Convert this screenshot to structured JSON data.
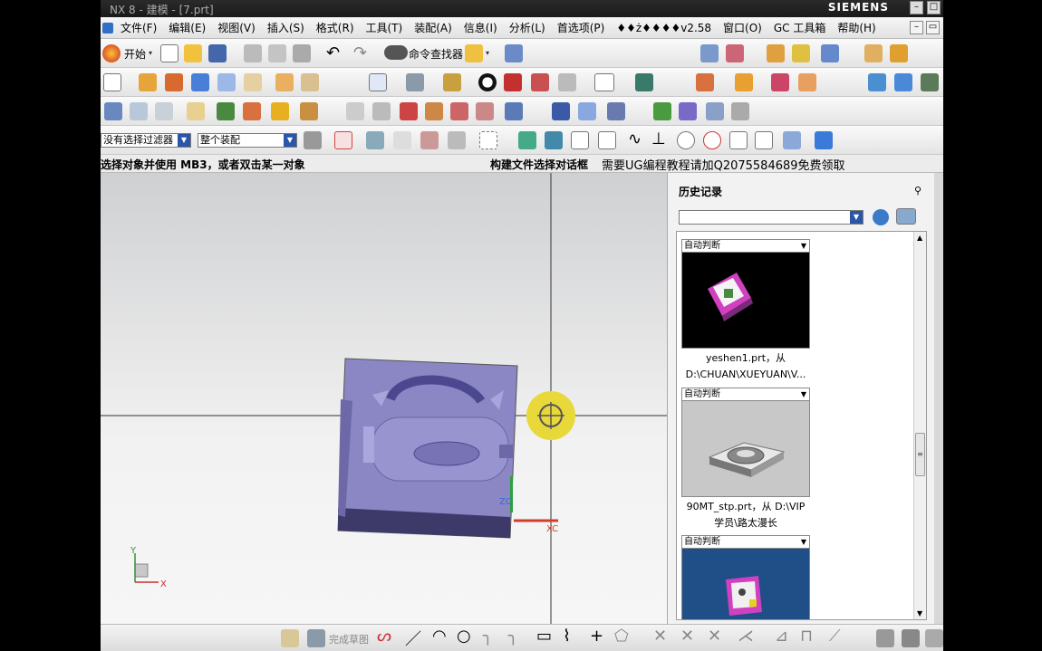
{
  "window": {
    "title": "NX 8 - 建模 - [7.prt]",
    "brand": "SIEMENS",
    "minimize": "–",
    "maximize": "□"
  },
  "menu": {
    "items": [
      "文件(F)",
      "编辑(E)",
      "视图(V)",
      "插入(S)",
      "格式(R)",
      "工具(T)",
      "装配(A)",
      "信息(I)",
      "分析(L)",
      "首选项(P)",
      "♦♦ż♦♦♦♦v2.58",
      "窗口(O)",
      "GC 工具箱",
      "帮助(H)"
    ],
    "mdi_minimize": "–",
    "mdi_restore": "▭"
  },
  "toolbar": {
    "start_label": "开始",
    "command_finder_label": "命令查找器"
  },
  "filters": {
    "type_filter": "没有选择过滤器",
    "scope_filter": "整个装配"
  },
  "status": {
    "prompt": "选择对象并使用 MB3，或者双击某一对象",
    "message": "构建文件选择对话框",
    "promo": "需要UG编程教程请加Q2075584689免费领取"
  },
  "viewport": {
    "axis_zc": "ZC",
    "axis_xc": "XC",
    "triad_y": "Y",
    "triad_x": "X",
    "colors": {
      "part": "#8b86c4",
      "part_dark": "#5c5890",
      "crosshair_dot": "#e8d83a"
    }
  },
  "history": {
    "title": "历史记录",
    "pin": "⚲",
    "entries": [
      {
        "mode": "自动判断",
        "caption_line1": "yeshen1.prt，从",
        "caption_line2": "D:\\CHUAN\\XUEYUAN\\V...",
        "bg": "#000000"
      },
      {
        "mode": "自动判断",
        "caption_line1": "90MT_stp.prt，从 D:\\VIP",
        "caption_line2": "学员\\路太漫长",
        "bg": "#c8c8c8"
      },
      {
        "mode": "自动判断",
        "caption_line1": "",
        "caption_line2": "",
        "bg": "#1f4f86"
      }
    ]
  },
  "bottombar": {
    "finish_sketch_label": "完成草图"
  }
}
